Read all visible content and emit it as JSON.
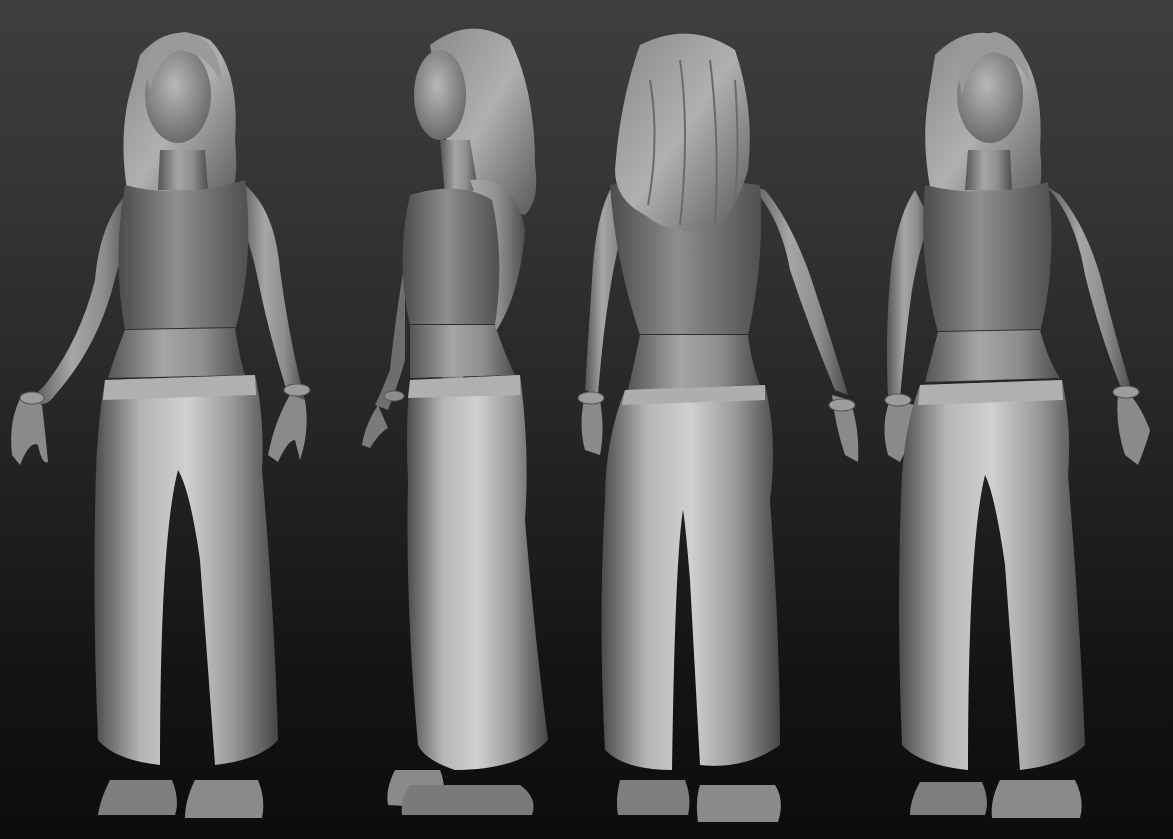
{
  "scene": {
    "colors": {
      "background_top": "#3e3e3e",
      "background_bottom": "#0c0c0c",
      "clay_light": "#c9c9c9",
      "clay_mid": "#8c8c8c",
      "clay_dark": "#3a3a3a"
    },
    "views": [
      {
        "view": "front-three-quarter"
      },
      {
        "view": "side-profile"
      },
      {
        "view": "back"
      },
      {
        "view": "front-three-quarter-mirrored"
      }
    ]
  }
}
